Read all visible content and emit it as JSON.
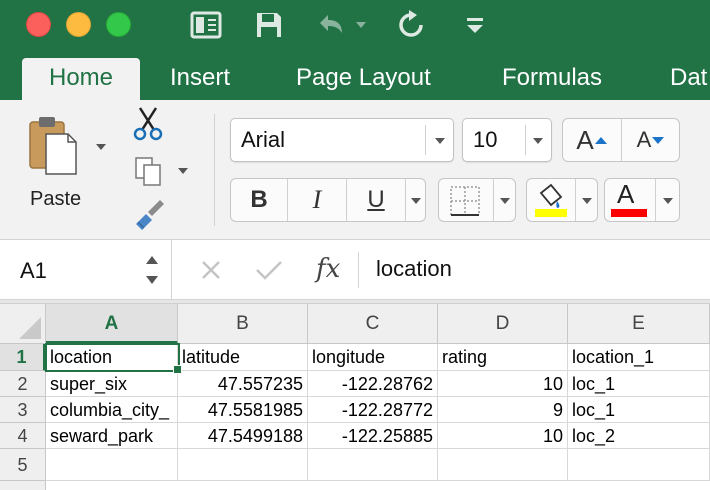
{
  "ribbon_tabs": [
    "Home",
    "Insert",
    "Page Layout",
    "Formulas",
    "Dat"
  ],
  "clipboard": {
    "paste_label": "Paste"
  },
  "font": {
    "name": "Arial",
    "size": "10"
  },
  "font_buttons": {
    "bold": "B",
    "italic": "I",
    "underline": "U",
    "font_color": "A",
    "increase": "A",
    "decrease": "A"
  },
  "colors": {
    "accent": "#217346",
    "highlight": "#ffff00",
    "font_color": "#ff0000"
  },
  "formula_bar": {
    "name_box": "A1",
    "fx": "fx",
    "content": "location"
  },
  "sheet": {
    "columns": [
      "A",
      "B",
      "C",
      "D",
      "E"
    ],
    "rows": [
      "1",
      "2",
      "3",
      "4",
      "5"
    ],
    "cells": [
      [
        "location",
        "latitude",
        "longitude",
        "rating",
        "location_1"
      ],
      [
        "super_six",
        "47.557235",
        "-122.28762",
        "10",
        "loc_1"
      ],
      [
        "columbia_city_",
        "47.5581985",
        "-122.28772",
        "9",
        "loc_1"
      ],
      [
        "seward_park",
        "47.5499188",
        "-122.25885",
        "10",
        "loc_2"
      ],
      [
        "",
        "",
        "",
        "",
        ""
      ]
    ],
    "selected_cell": "A1"
  }
}
